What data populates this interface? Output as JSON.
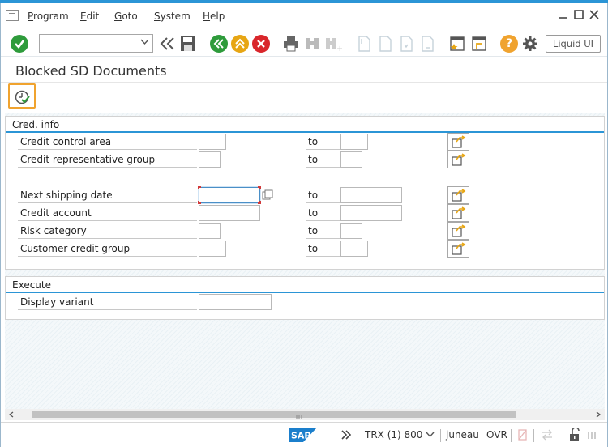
{
  "menu": {
    "items": [
      "Program",
      "Edit",
      "Goto",
      "System",
      "Help"
    ]
  },
  "toolbar": {
    "command_value": "",
    "liquid_ui_label": "Liquid UI"
  },
  "page": {
    "title": "Blocked SD Documents"
  },
  "groups": {
    "cred_info": {
      "title": "Cred. info",
      "rows": [
        {
          "label": "Credit control area",
          "to": "to"
        },
        {
          "label": "Credit representative group",
          "to": "to"
        },
        {
          "label": "Next shipping date",
          "to": "to"
        },
        {
          "label": "Credit account",
          "to": "to"
        },
        {
          "label": "Risk category",
          "to": "to"
        },
        {
          "label": "Customer credit group",
          "to": "to"
        }
      ]
    },
    "execute": {
      "title": "Execute",
      "rows": [
        {
          "label": "Display variant"
        }
      ]
    }
  },
  "status": {
    "system": "TRX (1) 800",
    "server": "juneau",
    "mode": "OVR"
  },
  "colors": {
    "accent": "#2b95d6",
    "execute_border": "#f0a32f",
    "ok_green": "#2e9b3b",
    "cancel_red": "#d9262b",
    "up_yellow": "#e7a614"
  }
}
